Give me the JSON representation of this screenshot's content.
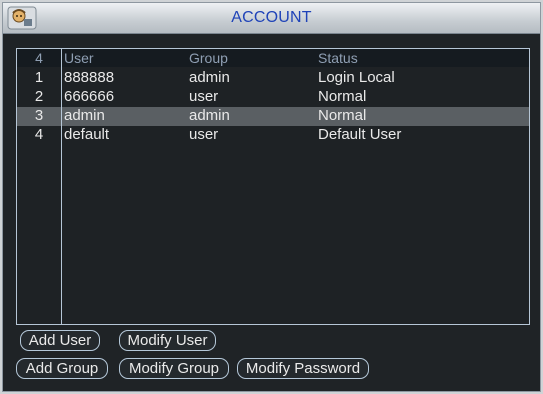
{
  "window": {
    "title": "ACCOUNT"
  },
  "table": {
    "headers": {
      "index": "4",
      "user": "User",
      "group": "Group",
      "status": "Status"
    },
    "rows": [
      {
        "index": "1",
        "user": "888888",
        "group": "admin",
        "status": "Login Local"
      },
      {
        "index": "2",
        "user": "666666",
        "group": "user",
        "status": "Normal"
      },
      {
        "index": "3",
        "user": "admin",
        "group": "admin",
        "status": "Normal"
      },
      {
        "index": "4",
        "user": "default",
        "group": "user",
        "status": "Default User"
      }
    ],
    "selected_row": 3
  },
  "buttons": {
    "add_user": "Add User",
    "modify_user": "Modify User",
    "add_group": "Add Group",
    "modify_group": "Modify Group",
    "modify_password": "Modify Password"
  },
  "colors": {
    "title_text": "#1f43b8",
    "panel_bg": "#1f2326",
    "selected_row_bg": "#5a5f63",
    "border": "#b6c6d6"
  },
  "icons": {
    "logo": "brand-logo-icon"
  }
}
